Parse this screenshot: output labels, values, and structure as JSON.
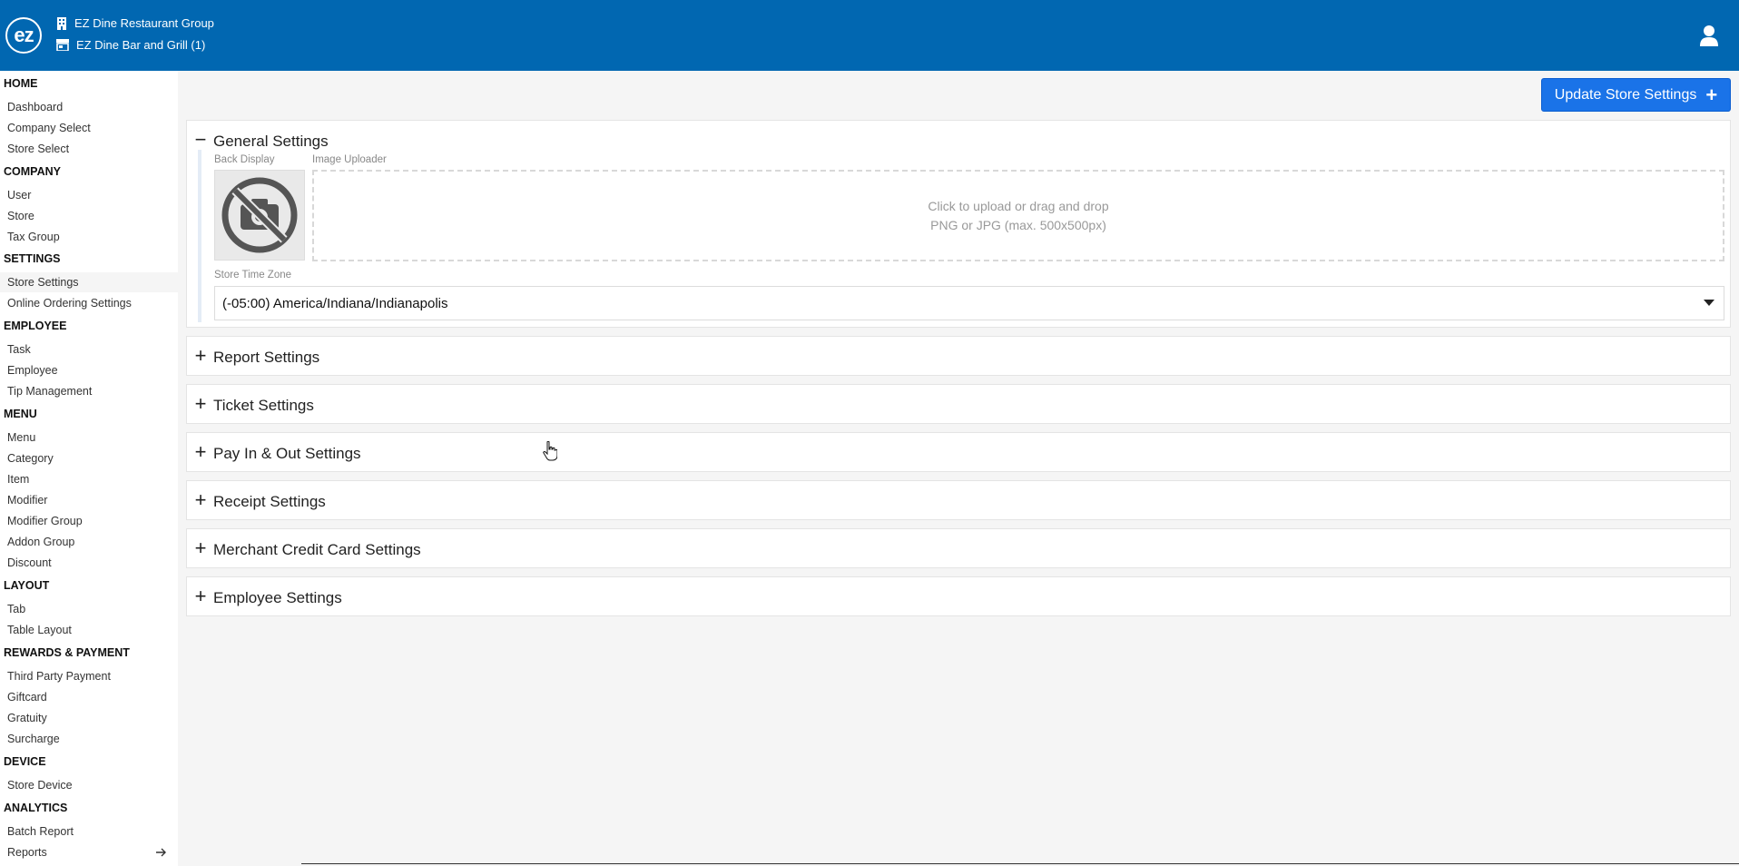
{
  "header": {
    "logo_text": "ez",
    "org_name": "EZ Dine Restaurant Group",
    "store_name": "EZ Dine Bar and Grill (1)",
    "org_icon": "building-icon",
    "store_icon": "store-icon",
    "user_icon": "user-icon",
    "bg_color": "#0167b1"
  },
  "sidebar": {
    "sections": [
      {
        "title": "HOME",
        "items": [
          "Dashboard",
          "Company Select",
          "Store Select"
        ]
      },
      {
        "title": "COMPANY",
        "items": [
          "User",
          "Store",
          "Tax Group"
        ]
      },
      {
        "title": "SETTINGS",
        "items": [
          "Store Settings",
          "Online Ordering Settings"
        ]
      },
      {
        "title": "EMPLOYEE",
        "items": [
          "Task",
          "Employee",
          "Tip Management"
        ]
      },
      {
        "title": "MENU",
        "items": [
          "Menu",
          "Category",
          "Item",
          "Modifier",
          "Modifier Group",
          "Addon Group",
          "Discount"
        ]
      },
      {
        "title": "LAYOUT",
        "items": [
          "Tab",
          "Table Layout"
        ]
      },
      {
        "title": "REWARDS & PAYMENT",
        "items": [
          "Third Party Payment",
          "Giftcard",
          "Gratuity",
          "Surcharge"
        ]
      },
      {
        "title": "DEVICE",
        "items": [
          "Store Device"
        ]
      },
      {
        "title": "ANALYTICS",
        "items": [
          "Batch Report",
          "Reports"
        ]
      }
    ],
    "active_item": "Store Settings"
  },
  "main": {
    "update_button": {
      "label": "Update Store Settings",
      "icon": "+",
      "color": "#1a73e8"
    },
    "general": {
      "title": "General Settings",
      "toggle": "−",
      "back_display_label": "Back Display",
      "image_uploader_label": "Image Uploader",
      "upload_text_1": "Click to upload or drag and drop",
      "upload_text_2": "PNG or JPG (max. 500x500px)",
      "time_zone_label": "Store Time Zone",
      "time_zone_value": "(-05:00) America/Indiana/Indianapolis"
    },
    "sections": [
      {
        "title": "Report Settings",
        "toggle": "+"
      },
      {
        "title": "Ticket Settings",
        "toggle": "+"
      },
      {
        "title": "Pay In & Out Settings",
        "toggle": "+"
      },
      {
        "title": "Receipt Settings",
        "toggle": "+"
      },
      {
        "title": "Merchant Credit Card Settings",
        "toggle": "+"
      },
      {
        "title": "Employee Settings",
        "toggle": "+"
      }
    ]
  }
}
